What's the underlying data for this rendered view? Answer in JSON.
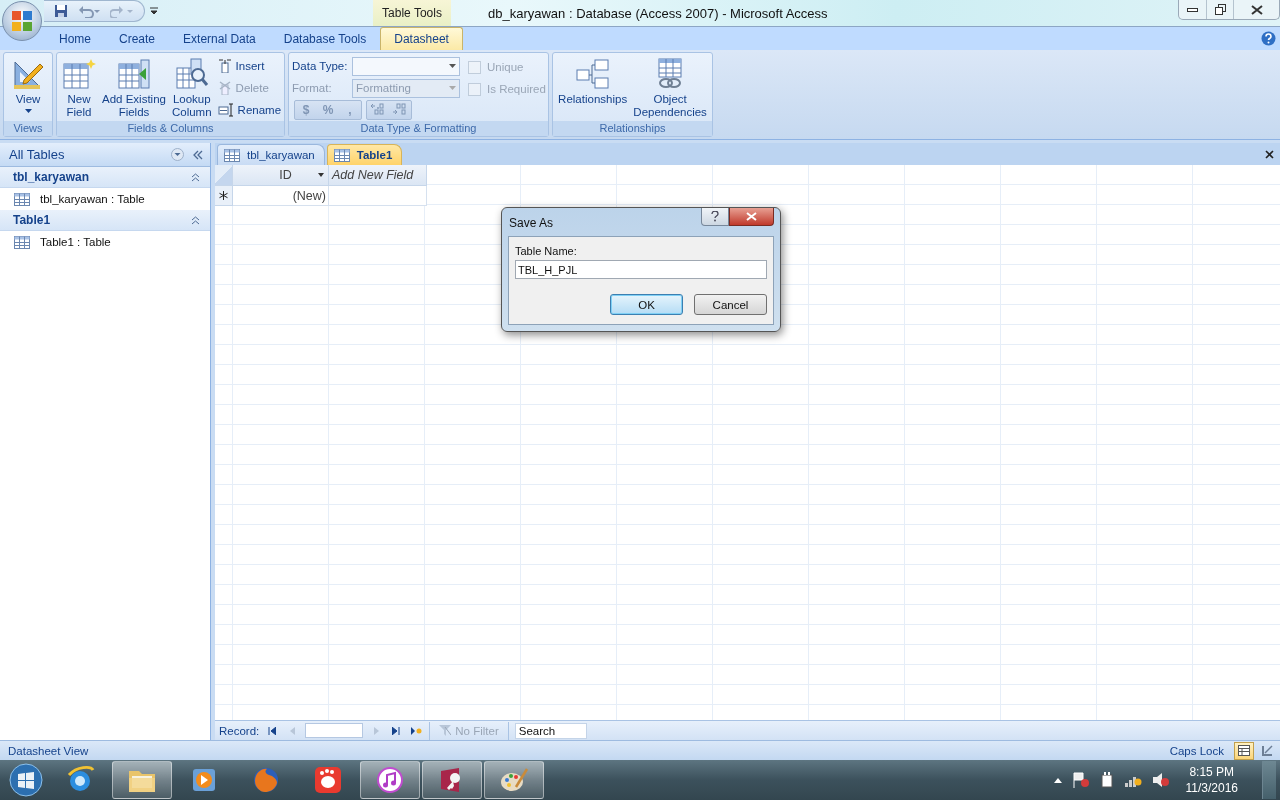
{
  "title_bar": {
    "contextual_label": "Table Tools",
    "title": "db_karyawan : Database (Access 2007) - Microsoft Access"
  },
  "ribbon_tabs": [
    {
      "label": "Home",
      "selected": false
    },
    {
      "label": "Create",
      "selected": false
    },
    {
      "label": "External Data",
      "selected": false
    },
    {
      "label": "Database Tools",
      "selected": false
    },
    {
      "label": "Datasheet",
      "selected": true
    }
  ],
  "ribbon": {
    "views": {
      "label": "Views",
      "view_button": {
        "label": "View"
      }
    },
    "fields_columns": {
      "label": "Fields & Columns",
      "large_buttons": [
        {
          "lines": [
            "New",
            "Field"
          ]
        },
        {
          "lines": [
            "Add Existing",
            "Fields"
          ]
        },
        {
          "lines": [
            "Lookup",
            "Column"
          ]
        }
      ],
      "small_buttons": [
        {
          "label": "Insert",
          "disabled": false
        },
        {
          "label": "Delete",
          "disabled": true
        },
        {
          "label": "Rename",
          "disabled": false
        }
      ]
    },
    "data_type_formatting": {
      "label": "Data Type & Formatting",
      "data_type": {
        "label": "Data Type:",
        "disabled": false
      },
      "format": {
        "label": "Format:",
        "value": "Formatting",
        "disabled": true
      },
      "checkboxes": [
        {
          "label": "Unique",
          "checked": false,
          "disabled": true
        },
        {
          "label": "Is Required",
          "checked": false,
          "disabled": true
        }
      ],
      "format_buttons": [
        {
          "label": "$"
        },
        {
          "label": "%"
        },
        {
          "label": ","
        }
      ]
    },
    "relationships": {
      "label": "Relationships",
      "large_buttons": [
        {
          "lines": [
            "Relationships"
          ]
        },
        {
          "lines": [
            "Object",
            "Dependencies"
          ]
        }
      ]
    }
  },
  "nav_pane": {
    "header": "All Tables",
    "groups": [
      {
        "name": "tbl_karyawan",
        "expanded": true,
        "items": [
          {
            "label": "tbl_karyawan : Table"
          }
        ]
      },
      {
        "name": "Table1",
        "expanded": true,
        "items": [
          {
            "label": "Table1 : Table"
          }
        ]
      }
    ]
  },
  "document_tabs": [
    {
      "label": "tbl_karyawan",
      "selected": false
    },
    {
      "label": "Table1",
      "selected": true
    }
  ],
  "datasheet": {
    "columns": [
      {
        "label": "ID",
        "kind": "field"
      },
      {
        "label": "Add New Field",
        "kind": "add"
      }
    ],
    "new_row": [
      "(New)"
    ]
  },
  "record_nav": {
    "label": "Record:",
    "filter": "No Filter",
    "search_placeholder": "Search"
  },
  "dialog": {
    "title": "Save As",
    "field_label": "Table Name:",
    "value": "TBL_H_PJL",
    "buttons": [
      {
        "label": "OK",
        "focused": true
      },
      {
        "label": "Cancel",
        "focused": false
      }
    ]
  },
  "status_bar": {
    "left": "Datasheet View",
    "right": "Caps Lock",
    "views": [
      {
        "selected": true
      },
      {
        "selected": false
      }
    ]
  },
  "taskbar": {
    "apps": [
      {
        "kind": "browser",
        "running": false
      },
      {
        "kind": "folder",
        "running": true
      },
      {
        "kind": "media",
        "running": false
      },
      {
        "kind": "firefox",
        "running": false
      },
      {
        "kind": "player",
        "running": false
      },
      {
        "kind": "music",
        "running": true
      },
      {
        "kind": "database",
        "running": true
      },
      {
        "kind": "paint",
        "running": true
      }
    ],
    "time": "8:15 PM",
    "date": "11/3/2016"
  }
}
